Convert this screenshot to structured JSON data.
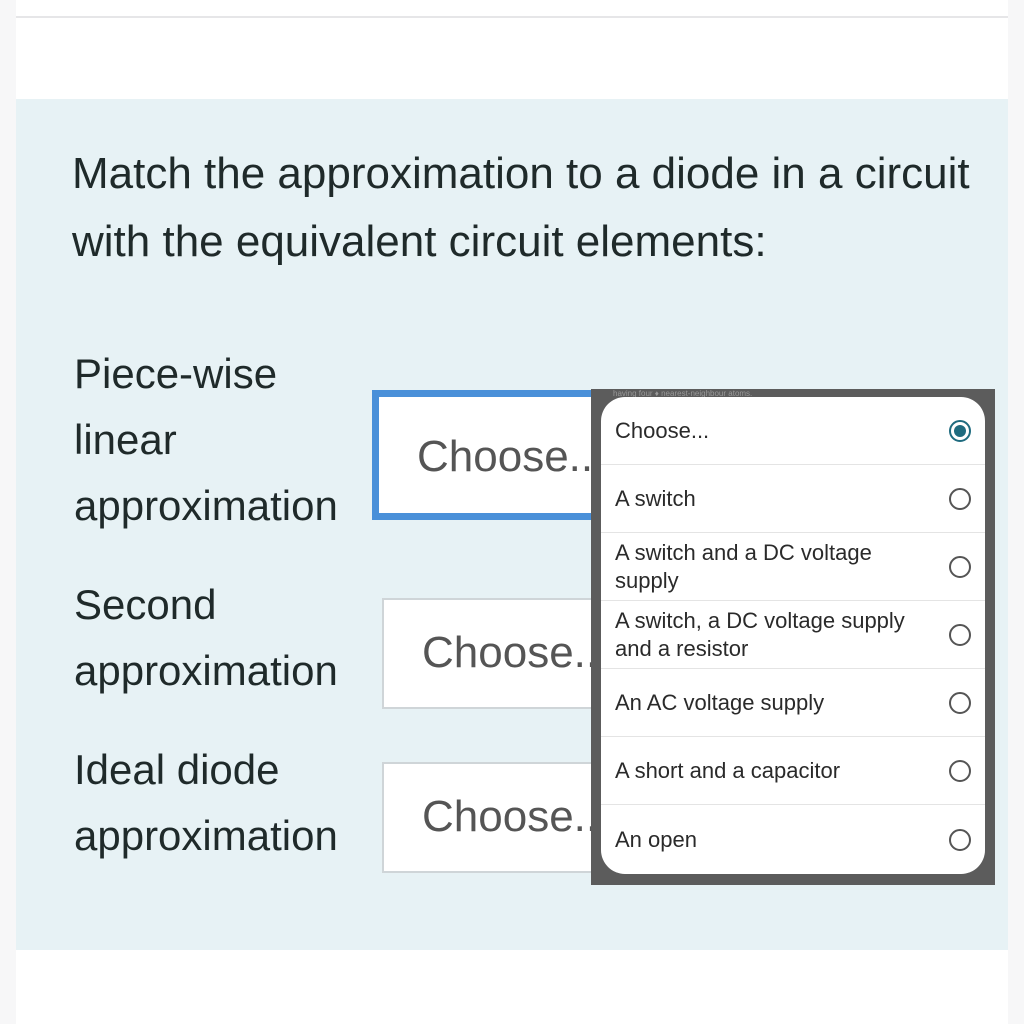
{
  "question": {
    "text": "Match the approximation to a diode in a circuit with the equivalent circuit elements:"
  },
  "rows": [
    {
      "label": "Piece-wise\nlinear\napproximation",
      "selected": "Choose..."
    },
    {
      "label": "Second\napproximation",
      "selected": "Choose..."
    },
    {
      "label": "Ideal diode\napproximation",
      "selected": "Choose..."
    }
  ],
  "dropdown": {
    "underlay_text": "having   four   ♦   nearest-neighbour atoms.",
    "options": [
      {
        "label": "Choose...",
        "checked": true
      },
      {
        "label": "A switch",
        "checked": false
      },
      {
        "label": "A switch and a DC voltage supply",
        "checked": false
      },
      {
        "label": "A switch, a DC voltage supply and a resistor",
        "checked": false
      },
      {
        "label": "An AC voltage supply",
        "checked": false
      },
      {
        "label": "A short and a capacitor",
        "checked": false
      },
      {
        "label": "An open",
        "checked": false
      }
    ]
  },
  "colors": {
    "panel": "#e7f2f5",
    "focus_border": "#4a90d9",
    "radio_checked": "#1f6b7f"
  }
}
